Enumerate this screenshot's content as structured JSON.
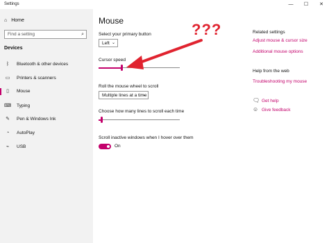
{
  "window": {
    "title": "Settings",
    "min": "—",
    "max": "☐",
    "close": "✕"
  },
  "sidebar": {
    "home_label": "Home",
    "search_placeholder": "Find a setting",
    "section": "Devices",
    "items": [
      {
        "label": "Bluetooth & other devices",
        "icon": "bluetooth-icon",
        "active": false
      },
      {
        "label": "Printers & scanners",
        "icon": "printer-icon",
        "active": false
      },
      {
        "label": "Mouse",
        "icon": "mouse-icon",
        "active": true
      },
      {
        "label": "Typing",
        "icon": "keyboard-icon",
        "active": false
      },
      {
        "label": "Pen & Windows Ink",
        "icon": "pen-icon",
        "active": false
      },
      {
        "label": "AutoPlay",
        "icon": "autoplay-icon",
        "active": false
      },
      {
        "label": "USB",
        "icon": "usb-icon",
        "active": false
      }
    ]
  },
  "main": {
    "title": "Mouse",
    "primary_button_label": "Select your primary button",
    "primary_button_value": "Left",
    "cursor_speed_label": "Cursor speed",
    "cursor_speed_level": 0.28,
    "scroll_label": "Roll the mouse wheel to scroll",
    "scroll_value": "Multiple lines at a time",
    "lines_label": "Choose how many lines to scroll each time",
    "lines_level": 0.03,
    "inactive_label": "Scroll inactive windows when I hover over them",
    "inactive_state": "On"
  },
  "related": {
    "heading": "Related settings",
    "link1": "Adjust mouse & cursor size",
    "link2": "Additional mouse options",
    "help_heading": "Help from the web",
    "help_link": "Troubleshooting my mouse",
    "get_help": "Get help",
    "give_feedback": "Give feedback"
  },
  "annotation": {
    "text": "???"
  },
  "colors": {
    "accent": "#c3006b",
    "annotation": "#e0232f",
    "sidebar_bg": "#f2f2f2"
  }
}
